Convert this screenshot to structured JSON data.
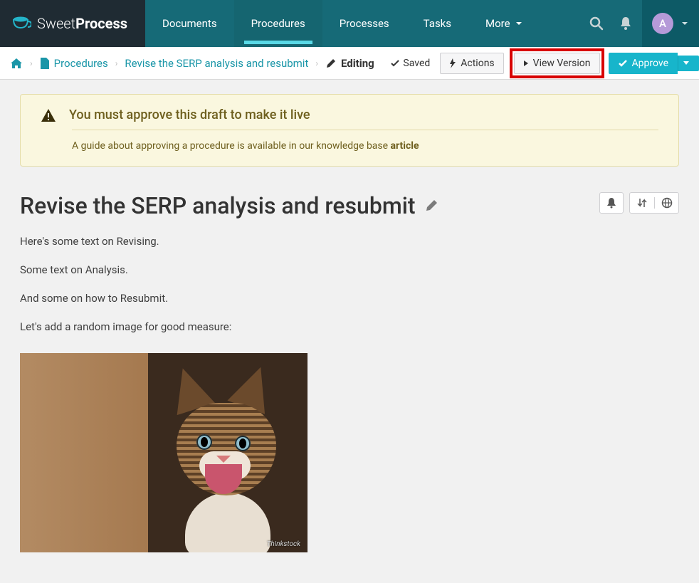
{
  "brand": {
    "part1": "Sweet",
    "part2": "Process"
  },
  "nav": {
    "documents": "Documents",
    "procedures": "Procedures",
    "processes": "Processes",
    "tasks": "Tasks",
    "more": "More"
  },
  "user": {
    "initial": "A"
  },
  "breadcrumb": {
    "procedures": "Procedures",
    "current": "Revise the SERP analysis and resubmit",
    "editing": "Editing"
  },
  "subbar": {
    "saved": "Saved",
    "actions": "Actions",
    "view_version": "View Version",
    "approve": "Approve"
  },
  "alert": {
    "title": "You must approve this draft to make it live",
    "body_pre": "A guide about approving a procedure is available in our knowledge base ",
    "body_link": "article"
  },
  "page": {
    "title": "Revise the SERP analysis and resubmit",
    "paragraphs": [
      "Here's some text on Revising.",
      "Some text on Analysis.",
      "And some on how to Resubmit.",
      "Let's add a random image for good measure:"
    ],
    "image_watermark": "Thinkstock"
  }
}
